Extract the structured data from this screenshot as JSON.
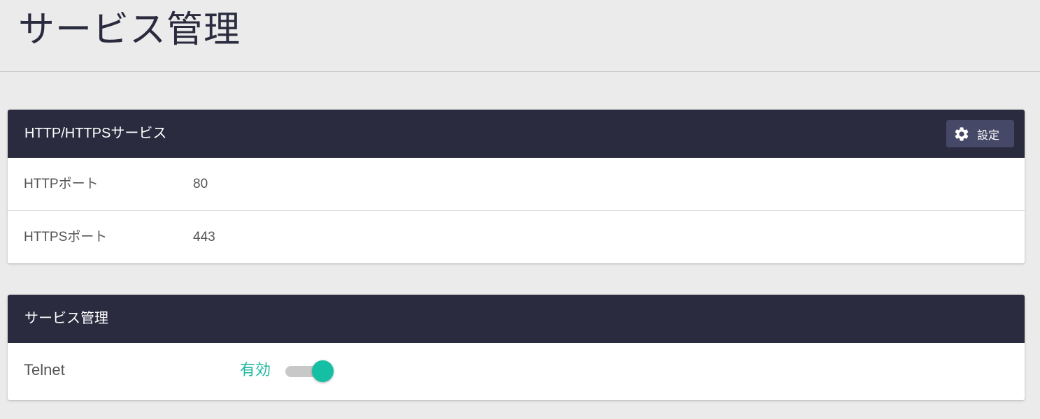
{
  "page": {
    "title": "サービス管理"
  },
  "http_card": {
    "title": "HTTP/HTTPSサービス",
    "settings_label": "設定",
    "rows": [
      {
        "label": "HTTPポート",
        "value": "80"
      },
      {
        "label": "HTTPSポート",
        "value": "443"
      }
    ]
  },
  "service_card": {
    "title": "サービス管理",
    "items": [
      {
        "label": "Telnet",
        "status": "有効",
        "enabled": true
      }
    ]
  },
  "colors": {
    "header_bg": "#2a2b3e",
    "button_bg": "#464868",
    "accent": "#15bfa3",
    "page_bg": "#ebebeb"
  },
  "icons": {
    "settings": "gear-icon"
  }
}
